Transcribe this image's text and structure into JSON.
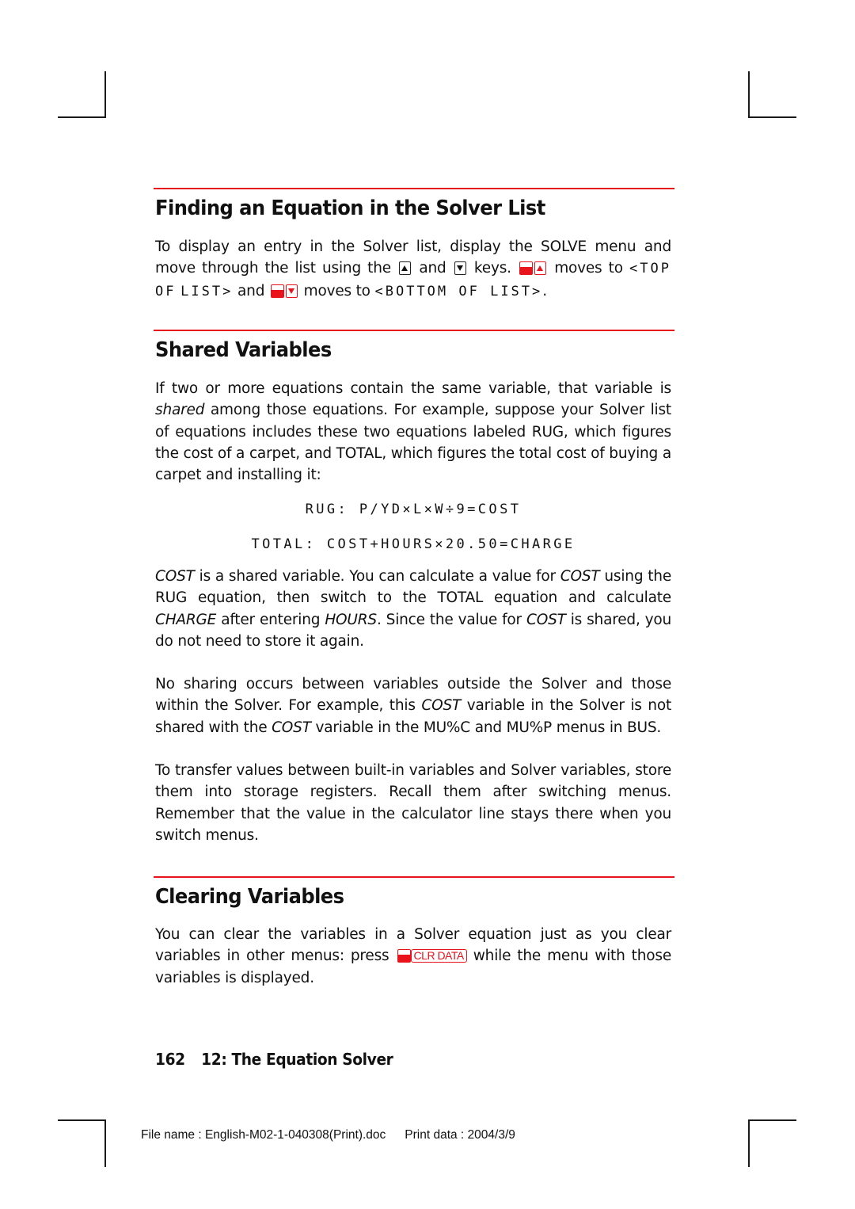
{
  "sections": [
    {
      "heading": "Finding an Equation in the Solver List",
      "para": {
        "t1": "To display an entry in the Solver list, display the SOLVE menu and move through the list using the",
        "t2": "and",
        "t3": "keys.",
        "t4": "moves to",
        "lcd1": "<TOP OF",
        "lcd2": "LIST>",
        "t5": "and",
        "t6": "moves to",
        "lcd3": "<BOTTOM OF LIST>",
        "t7": "."
      },
      "keys": [
        "up-arrow-key",
        "down-arrow-key",
        "shift-up-arrow-key",
        "shift-down-arrow-key"
      ]
    },
    {
      "heading": "Shared Variables",
      "para1": {
        "t1": "If two or more equations contain the same variable, that variable is",
        "i1": "shared",
        "t2": "among those equations. For example, suppose your Solver list of equations includes these two equations labeled RUG, which figures the cost of a carpet, and TOTAL, which figures the total cost of buying a carpet and installing it:"
      },
      "equations": [
        "RUG: P/YD×L×W÷9=COST",
        "TOTAL: COST+HOURS×20.50=CHARGE"
      ],
      "para2": {
        "i1": "COST",
        "t1": "is a shared variable. You can calculate a value for",
        "i2": "COST",
        "t2": "using the RUG equation, then switch to the TOTAL equation and calculate",
        "i3": "CHARGE",
        "t3": "after entering",
        "i4": "HOURS",
        "t4": ". Since the value for",
        "i5": "COST",
        "t5": "is shared, you do not need to store it again."
      },
      "para3": {
        "t1": "No sharing occurs between variables outside the Solver and those within the Solver. For example, this",
        "i1": "COST",
        "t2": "variable in the Solver is not shared with the",
        "i2": "COST",
        "t3": "variable in the MU%C and MU%P menus in BUS."
      },
      "para4": "To transfer values between built-in variables and Solver variables, store them into storage registers. Recall them after switching menus. Remember that the value in the calculator line stays there when you switch menus."
    },
    {
      "heading": "Clearing Variables",
      "para": {
        "t1": "You can clear the variables in a Solver equation just as you clear variables in other menus: press",
        "key_label": "CLR DATA",
        "t2": "while the menu with those variables is displayed."
      }
    }
  ],
  "footer": {
    "page_number": "162",
    "chapter": "12: The Equation Solver"
  },
  "print_info": {
    "file_name": "File name : English-M02-1-040308(Print).doc",
    "print_date": "Print data : 2004/3/9"
  },
  "colors": {
    "accent_red": "#e8131b",
    "text": "#111111"
  }
}
